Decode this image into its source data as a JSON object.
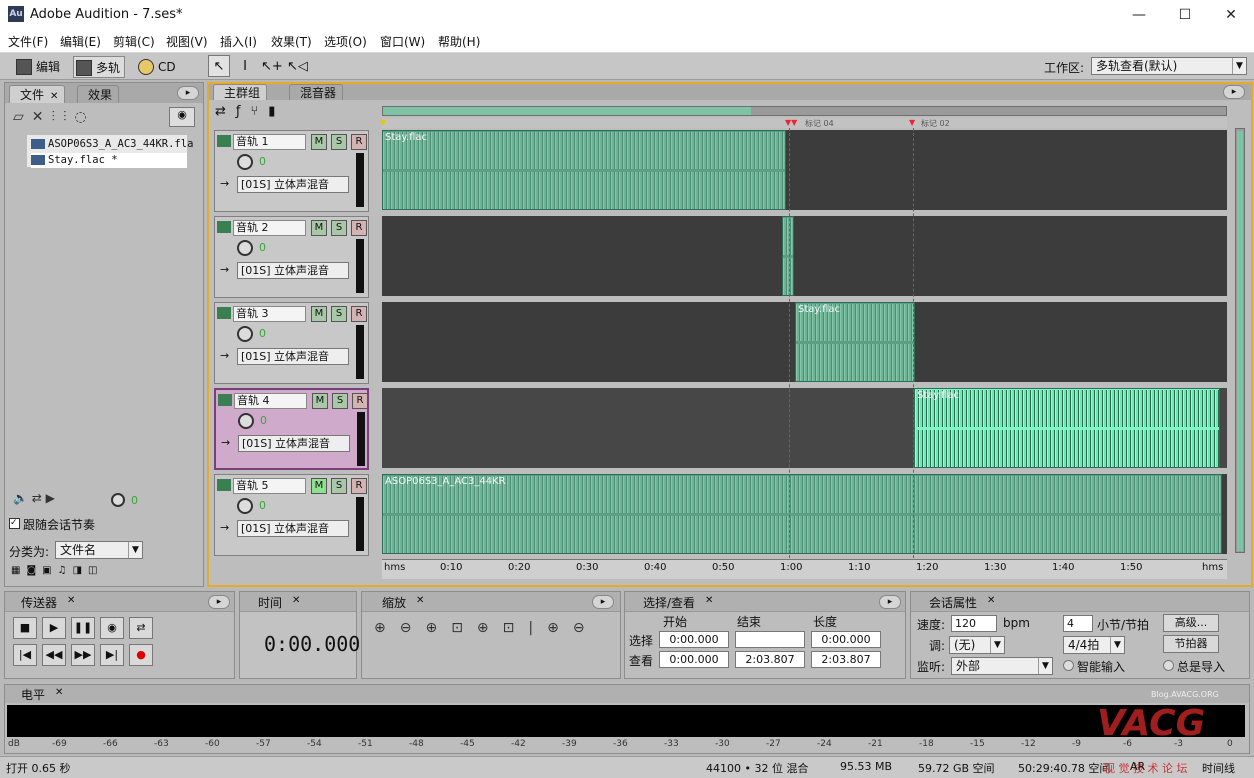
{
  "window": {
    "app_icon": "Au",
    "title": "Adobe Audition - 7.ses*",
    "minimize": "—",
    "maximize": "☐",
    "close": "✕"
  },
  "menu": [
    "文件(F)",
    "编辑(E)",
    "剪辑(C)",
    "视图(V)",
    "插入(I)",
    "效果(T)",
    "选项(O)",
    "窗口(W)",
    "帮助(H)"
  ],
  "toolbar": {
    "edit": "编辑",
    "multitrack": "多轨",
    "cd": "CD",
    "workspace_label": "工作区:",
    "workspace_value": "多轨查看(默认)"
  },
  "files_panel": {
    "tab_files": "文件",
    "tab_effects": "效果",
    "items": [
      "ASOP06S3_A_AC3_44KR.fla",
      "Stay.flac *"
    ],
    "volume": "0",
    "follow_label": "跟随会话节奏",
    "sort_label": "分类为:",
    "sort_value": "文件名"
  },
  "session_panel": {
    "tab_main": "主群组",
    "tab_mixer": "混音器",
    "tracks": [
      {
        "name": "音轨 1",
        "volume": "0",
        "bus": "[01S] 立体声混音"
      },
      {
        "name": "音轨 2",
        "volume": "0",
        "bus": "[01S] 立体声混音"
      },
      {
        "name": "音轨 3",
        "volume": "0",
        "bus": "[01S] 立体声混音"
      },
      {
        "name": "音轨 4",
        "volume": "0",
        "bus": "[01S] 立体声混音"
      },
      {
        "name": "音轨 5",
        "volume": "0",
        "bus": "[01S] 立体声混音"
      }
    ],
    "msr": [
      "M",
      "S",
      "R"
    ],
    "clips": [
      "Stay.flac",
      "Stay.flac",
      "Stay.flac",
      "ASOP06S3_A_AC3_44KR"
    ],
    "markers": [
      "标记 04",
      "标记 02"
    ],
    "ruler": [
      "hms",
      "0:10",
      "0:20",
      "0:30",
      "0:40",
      "0:50",
      "1:00",
      "1:10",
      "1:20",
      "1:30",
      "1:40",
      "1:50",
      "hms"
    ]
  },
  "transport": {
    "title": "传送器"
  },
  "time": {
    "title": "时间",
    "value": "0:00.000"
  },
  "zoom": {
    "title": "缩放"
  },
  "selection": {
    "title": "选择/查看",
    "col_start": "开始",
    "col_end": "结束",
    "col_length": "长度",
    "row_select": "选择",
    "row_view": "查看",
    "sel_start": "0:00.000",
    "sel_end": "",
    "sel_length": "0:00.000",
    "view_start": "0:00.000",
    "view_end": "2:03.807",
    "view_length": "2:03.807"
  },
  "session_props": {
    "title": "会话属性",
    "tempo_label": "速度:",
    "tempo_value": "120",
    "tempo_unit": "bpm",
    "bars_value": "4",
    "bars_label": "小节/节拍",
    "advanced": "高级...",
    "key_label": "调:",
    "key_value": "(无)",
    "meter_value": "4/4拍",
    "metronome": "节拍器",
    "monitor_label": "监听:",
    "monitor_value": "外部",
    "smart_input": "智能输入",
    "always_input": "总是导入"
  },
  "levels": {
    "title": "电平",
    "ticks": [
      "dB",
      "-69",
      "-66",
      "-63",
      "-60",
      "-57",
      "-54",
      "-51",
      "-48",
      "-45",
      "-42",
      "-39",
      "-36",
      "-33",
      "-30",
      "-27",
      "-24",
      "-21",
      "-18",
      "-15",
      "-12",
      "-9",
      "-6",
      "-3",
      "0"
    ],
    "watermark": "VACG",
    "watermark_url": "Blog.AVACG.ORG",
    "watermark_sub": "视 觉 技 术 论 坛"
  },
  "status": {
    "open_time": "打开 0.65 秒",
    "format": "44100 • 32 位 混合",
    "ram": "95.53 MB",
    "disk": "59.72 GB 空间",
    "duration": "50:29:40.78 空间",
    "ar": "AR",
    "mode": "时间线"
  }
}
